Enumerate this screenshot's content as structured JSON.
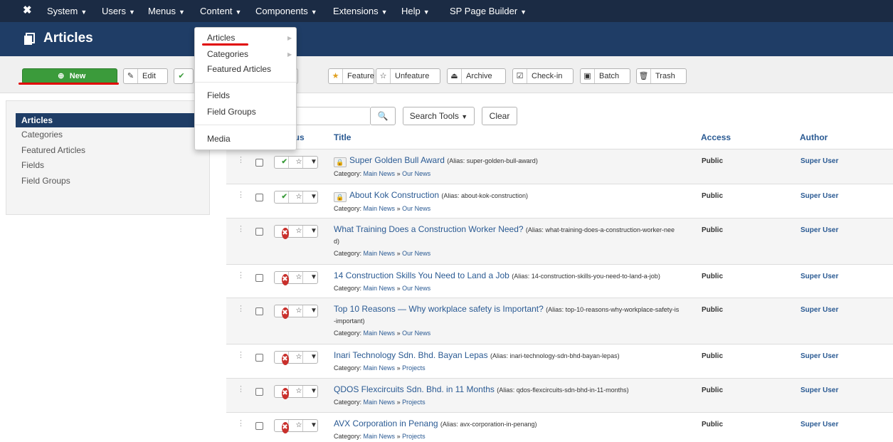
{
  "topnav": {
    "logo": "joomla-logo",
    "menus": [
      {
        "label": "System"
      },
      {
        "label": "Users"
      },
      {
        "label": "Menus"
      },
      {
        "label": "Content"
      },
      {
        "label": "Components"
      },
      {
        "label": "Extensions"
      },
      {
        "label": "Help"
      },
      {
        "label": "SP Page Builder"
      }
    ]
  },
  "content_menu": {
    "items": [
      "Articles",
      "Categories",
      "Featured Articles",
      "Fields",
      "Field Groups",
      "Media"
    ]
  },
  "titlebar": {
    "title": "Articles"
  },
  "toolbar": {
    "new": "New",
    "edit": "Edit",
    "feature": "Feature",
    "unfeature": "Unfeature",
    "archive": "Archive",
    "checkin": "Check-in",
    "batch": "Batch",
    "trash": "Trash"
  },
  "sidebar": {
    "items": [
      "Articles",
      "Categories",
      "Featured Articles",
      "Fields",
      "Field Groups"
    ],
    "active_index": 0
  },
  "search": {
    "search_tools": "Search Tools",
    "clear": "Clear"
  },
  "table": {
    "headers": {
      "status": "Status",
      "title": "Title",
      "access": "Access",
      "author": "Author"
    },
    "alias_label": "Alias:",
    "category_label": "Category:",
    "rows": [
      {
        "title": "Super Golden Bull Award",
        "alias": "super-golden-bull-award",
        "alias_line2": "",
        "parent": "Main News",
        "category": "Our News",
        "access": "Public",
        "author": "Super User",
        "published": true,
        "locked": true
      },
      {
        "title": "About Kok Construction",
        "alias": "about-kok-construction",
        "alias_line2": "",
        "parent": "Main News",
        "category": "Our News",
        "access": "Public",
        "author": "Super User",
        "published": true,
        "locked": true
      },
      {
        "title": "What Training Does a Construction Worker Need?",
        "alias": "what-training-does-a-construction-worker-nee",
        "alias_line2": "d)",
        "parent": "Main News",
        "category": "Our News",
        "access": "Public",
        "author": "Super User",
        "published": false,
        "locked": false
      },
      {
        "title": "14 Construction Skills You Need to Land a Job",
        "alias": "14-construction-skills-you-need-to-land-a-job",
        "alias_line2": "",
        "parent": "Main News",
        "category": "Our News",
        "access": "Public",
        "author": "Super User",
        "published": false,
        "locked": false
      },
      {
        "title": "Top 10 Reasons — Why workplace safety is Important?",
        "alias": "top-10-reasons-why-workplace-safety-is",
        "alias_line2": "-important)",
        "parent": "Main News",
        "category": "Our News",
        "access": "Public",
        "author": "Super User",
        "published": false,
        "locked": false
      },
      {
        "title": "Inari Technology Sdn. Bhd. Bayan Lepas",
        "alias": "inari-technology-sdn-bhd-bayan-lepas",
        "alias_line2": "",
        "parent": "Main News",
        "category": "Projects",
        "access": "Public",
        "author": "Super User",
        "published": false,
        "locked": false
      },
      {
        "title": "QDOS Flexcircuits Sdn. Bhd. in 11 Months",
        "alias": "qdos-flexcircuits-sdn-bhd-in-11-months",
        "alias_line2": "",
        "parent": "Main News",
        "category": "Projects",
        "access": "Public",
        "author": "Super User",
        "published": false,
        "locked": false
      },
      {
        "title": "AVX Corporation in Penang",
        "alias": "avx-corporation-in-penang",
        "alias_line2": "",
        "parent": "Main News",
        "category": "Projects",
        "access": "Public",
        "author": "Super User",
        "published": false,
        "locked": false
      }
    ]
  },
  "colors": {
    "topnav_bg": "#1b2b44",
    "titlebar_bg": "#1f3d66",
    "new_button": "#3b9b3b",
    "link": "#2a5a93",
    "annotation_underline": "#e00000",
    "unpublished": "#c9302c"
  }
}
